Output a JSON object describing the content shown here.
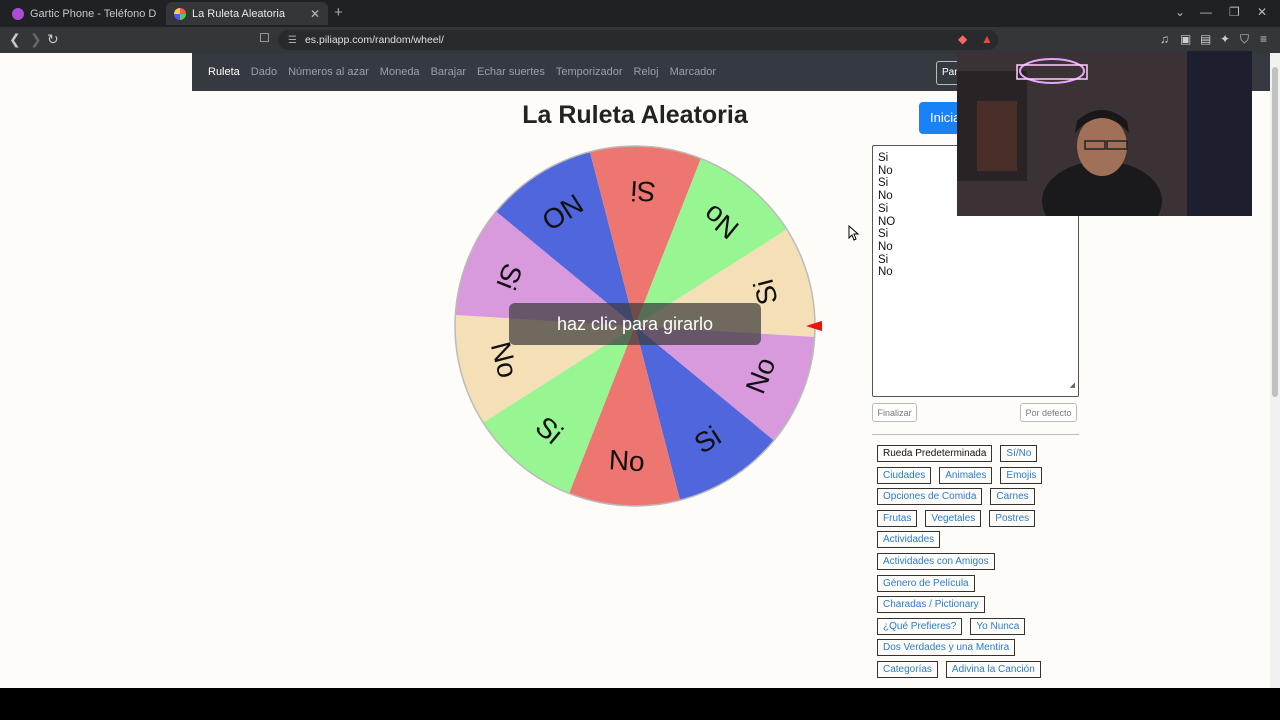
{
  "browser": {
    "tabs": [
      {
        "title": "Gartic Phone - Teléfono Descomp",
        "active": false
      },
      {
        "title": "La Ruleta Aleatoria",
        "active": true
      }
    ],
    "url": "es.piliapp.com/random/wheel/"
  },
  "nav": {
    "items": [
      "Ruleta",
      "Dado",
      "Números al azar",
      "Moneda",
      "Barajar",
      "Echar suertes",
      "Temporizador",
      "Reloj",
      "Marcador"
    ],
    "active": "Ruleta",
    "pan_label": "Pan"
  },
  "page": {
    "title": "La Ruleta Aleatoria",
    "start_label": "Inicia"
  },
  "wheel": {
    "tooltip": "haz clic para girarlo",
    "segments": [
      {
        "label": "Si",
        "color": "#f5dfb6"
      },
      {
        "label": "No",
        "color": "#d899dd"
      },
      {
        "label": "Si",
        "color": "#4f66dc"
      },
      {
        "label": "No",
        "color": "#ee7670"
      },
      {
        "label": "Si",
        "color": "#97f592"
      },
      {
        "label": "No",
        "color": "#f5dfb6"
      },
      {
        "label": "Si",
        "color": "#d899dd"
      },
      {
        "label": "NO",
        "color": "#4f66dc"
      },
      {
        "label": "Si",
        "color": "#ee7670"
      },
      {
        "label": "No",
        "color": "#97f592"
      }
    ],
    "pointer_color": "#e8160f"
  },
  "options": {
    "lines": [
      "Si",
      "No",
      "Si",
      "No",
      "Si",
      "NO",
      "Si",
      "No",
      "Si",
      "No"
    ],
    "finish_label": "Finalizar",
    "default_label": "Por defecto"
  },
  "presets": [
    {
      "label": "Rueda Predeterminada",
      "selected": true
    },
    {
      "label": "Sí/No"
    },
    {
      "label": "Ciudades"
    },
    {
      "label": "Animales"
    },
    {
      "label": "Emojis"
    },
    {
      "label": "Opciones de Comida"
    },
    {
      "label": "Carnes"
    },
    {
      "label": "Frutas"
    },
    {
      "label": "Vegetales"
    },
    {
      "label": "Postres"
    },
    {
      "label": "Actividades"
    },
    {
      "label": "Actividades con Amigos"
    },
    {
      "label": "Género de Película"
    },
    {
      "label": "Charadas / Pictionary"
    },
    {
      "label": "¿Qué Prefieres?"
    },
    {
      "label": "Yo Nunca"
    },
    {
      "label": "Dos Verdades y una Mentira"
    },
    {
      "label": "Categorías"
    },
    {
      "label": "Adivina la Canción"
    }
  ]
}
